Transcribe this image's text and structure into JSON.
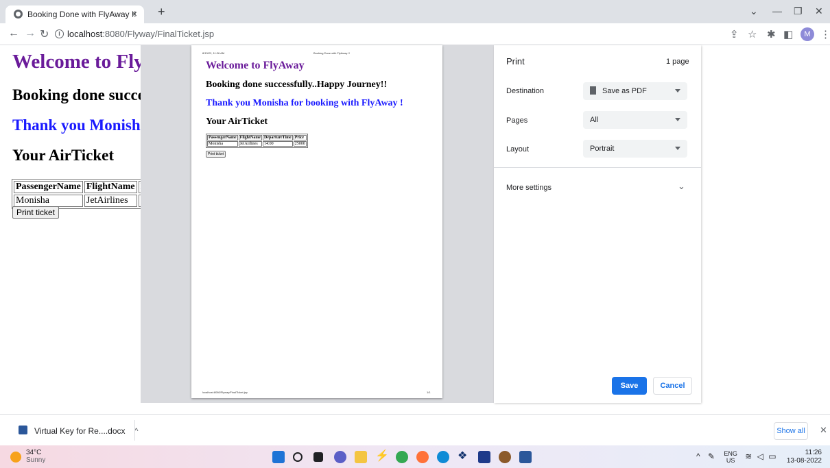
{
  "browser": {
    "tab_title": "Booking Done with FlyAway !!",
    "tab_close": "×",
    "new_tab": "+",
    "url_host": "localhost",
    "url_path": ":8080/Flyway/FinalTicket.jsp",
    "avatar_initial": "M"
  },
  "page": {
    "welcome": "Welcome to FlyAway",
    "booking_done": "Booking done successfully..Happy Journey!!",
    "thank_you": "Thank you Monisha for booking with FlyAway !",
    "your_ticket": "Your AirTicket",
    "table": {
      "headers": [
        "PassengerName",
        "FlightName",
        "DepartureTime",
        "Price"
      ],
      "row": [
        "Monisha",
        "JetAirlines",
        "14:00",
        "25000"
      ]
    },
    "print_button": "Print ticket"
  },
  "print_preview": {
    "header_date": "8/13/22, 11:26 AM",
    "header_title": "Booking Done with FlyAway !!",
    "footer_url": "localhost:8080/Flyway/FinalTicket.jsp",
    "footer_page": "1/1"
  },
  "print_dialog": {
    "title": "Print",
    "page_count": "1 page",
    "destination_label": "Destination",
    "destination_value": "Save as PDF",
    "pages_label": "Pages",
    "pages_value": "All",
    "layout_label": "Layout",
    "layout_value": "Portrait",
    "more_settings": "More settings",
    "save_button": "Save",
    "cancel_button": "Cancel"
  },
  "downloads": {
    "item_name": "Virtual Key for Re....docx",
    "show_all": "Show all"
  },
  "taskbar": {
    "temperature": "34°C",
    "weather": "Sunny",
    "lang_top": "ENG",
    "lang_bottom": "US",
    "time": "11:26",
    "date": "13-08-2022"
  },
  "colors": {
    "welcome_purple": "#6a1b9a",
    "thank_you_blue": "#1a1aff",
    "accent_blue": "#1a73e8"
  }
}
